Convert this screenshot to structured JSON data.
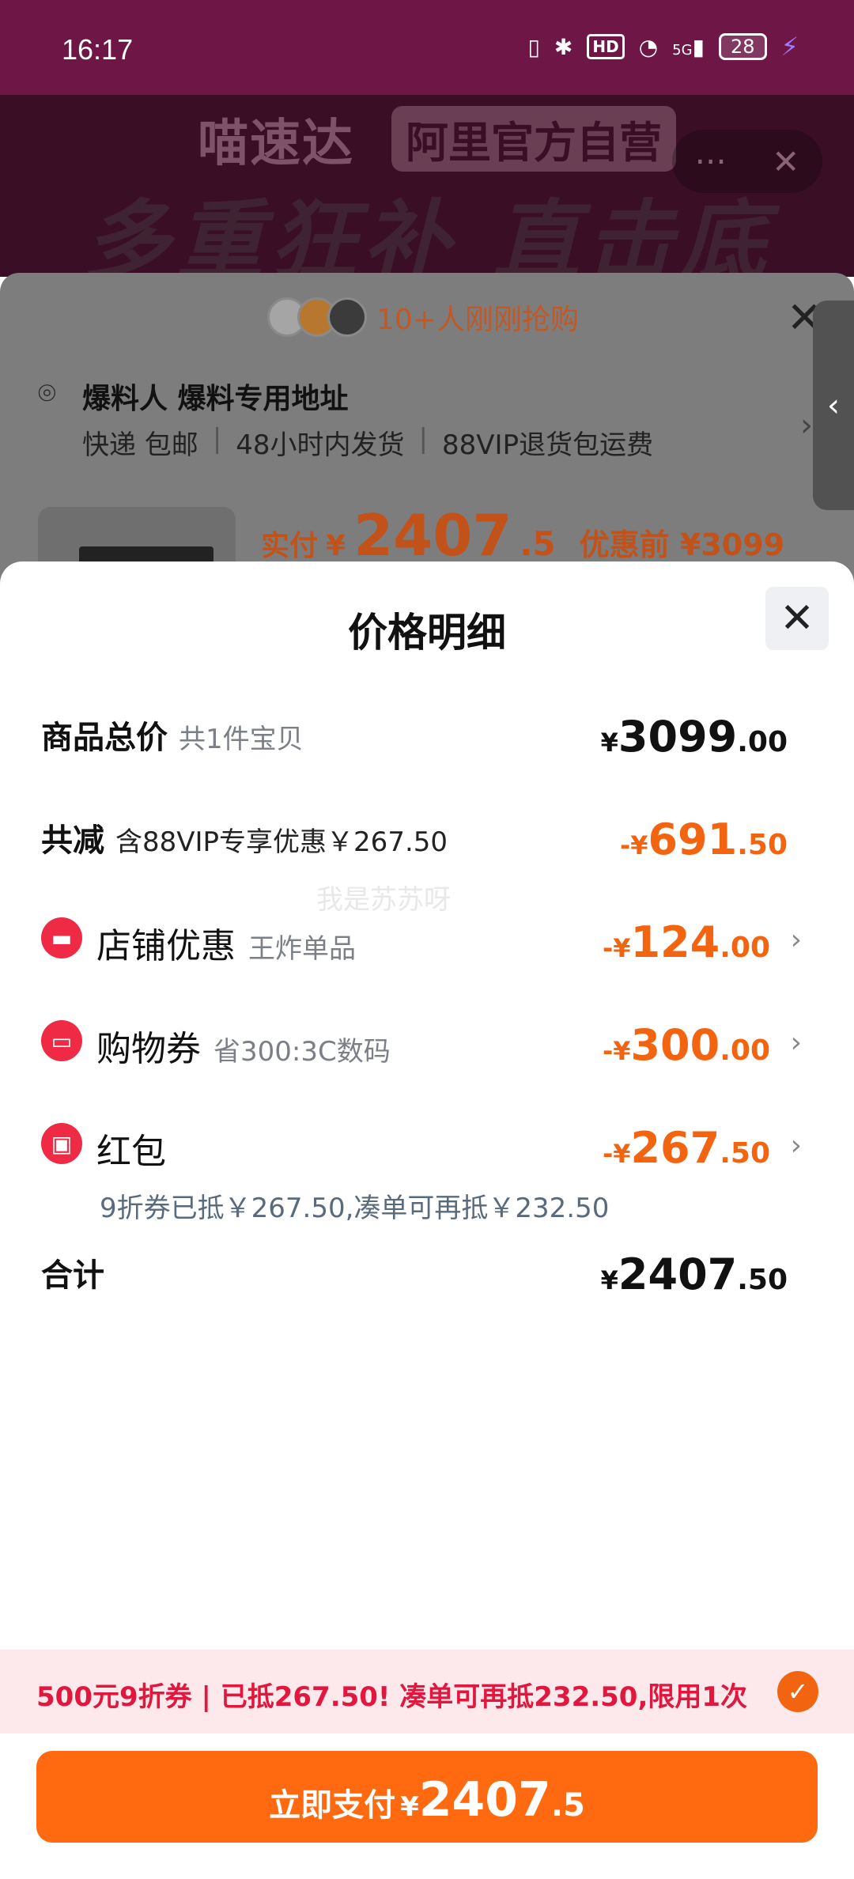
{
  "status_bar": {
    "time": "16:17",
    "hd": "HD",
    "network": "5G",
    "battery": "28"
  },
  "banner": {
    "brand": "喵速达",
    "brand_badge": "阿里官方自营",
    "slogan": "多重狂补 直击底价"
  },
  "order_sheet": {
    "buyers_text": "10+人刚刚抢购",
    "address_name": "爆料人 爆料专用地址",
    "shipping_info": [
      "快递 包邮",
      "48小时内发货",
      "88VIP退货包运费"
    ],
    "price_label": "实付",
    "price_currency": "¥",
    "price_int": "2407",
    "price_dec": ".5",
    "original_price": "优惠前 ¥3099"
  },
  "modal": {
    "title": "价格明细",
    "total": {
      "label": "商品总价",
      "sub": "共1件宝贝",
      "cur": "¥",
      "int": "3099",
      "dec": ".00"
    },
    "discount": {
      "label": "共减",
      "sub": "含88VIP专享优惠￥267.50",
      "cur": "-¥",
      "int": "691",
      "dec": ".50"
    },
    "store": {
      "label": "店铺优惠",
      "sub": "王炸单品",
      "cur": "-¥",
      "int": "124",
      "dec": ".00"
    },
    "voucher": {
      "label": "购物券",
      "sub": "省300:3C数码",
      "cur": "-¥",
      "int": "300",
      "dec": ".00"
    },
    "red_packet": {
      "label": "红包",
      "note": "9折券已抵￥267.50,凑单可再抵￥232.50",
      "cur": "-¥",
      "int": "267",
      "dec": ".50"
    },
    "sum": {
      "label": "合计",
      "cur": "¥",
      "int": "2407",
      "dec": ".50"
    }
  },
  "watermark": "我是苏苏呀",
  "promo": {
    "text": "500元9折券 | 已抵267.50! 凑单可再抵232.50,限用1次"
  },
  "pay_button": {
    "label": "立即支付",
    "cur": "¥",
    "int": "2407",
    "dec": ".5"
  },
  "colors": {
    "accent_orange": "#ff6a10",
    "promo_red": "#e1173d",
    "status_bar": "#6e1646"
  }
}
